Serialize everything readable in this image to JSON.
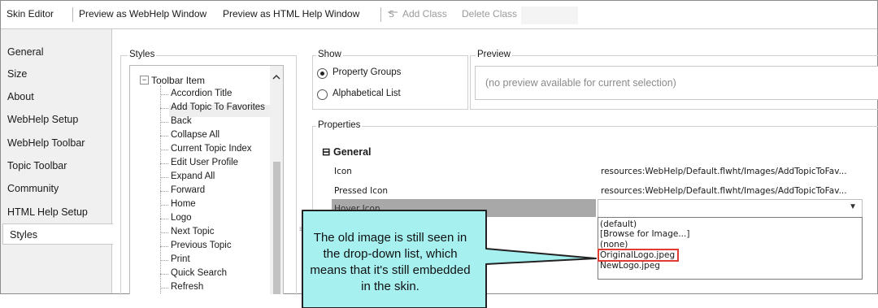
{
  "toolbar": {
    "skin_editor": "Skin Editor",
    "preview_webhelp": "Preview as WebHelp Window",
    "preview_htmlhelp": "Preview as HTML Help Window",
    "add_class": "Add Class",
    "delete_class": "Delete Class",
    "add_class_icon": "class-icon"
  },
  "nav": {
    "items": [
      {
        "label": "General"
      },
      {
        "label": "Size"
      },
      {
        "label": "About"
      },
      {
        "label": "WebHelp Setup"
      },
      {
        "label": "WebHelp Toolbar"
      },
      {
        "label": "Topic Toolbar"
      },
      {
        "label": "Community"
      },
      {
        "label": "HTML Help Setup"
      },
      {
        "label": "Styles"
      }
    ],
    "selected": "Styles"
  },
  "styles": {
    "group_label": "Styles",
    "root": "Toolbar Item",
    "items": [
      "Accordion Title",
      "Add Topic To Favorites",
      "Back",
      "Collapse All",
      "Current Topic Index",
      "Edit User Profile",
      "Expand All",
      "Forward",
      "Home",
      "Logo",
      "Next Topic",
      "Previous Topic",
      "Print",
      "Quick Search",
      "Refresh"
    ],
    "selected": "Add Topic To Favorites"
  },
  "show": {
    "group_label": "Show",
    "options": [
      "Property Groups",
      "Alphabetical List"
    ],
    "selected": "Property Groups"
  },
  "preview": {
    "group_label": "Preview",
    "text": "(no preview available for current selection)"
  },
  "properties": {
    "group_label": "Properties",
    "section_toggle": "⊟",
    "section": "General",
    "rows": [
      {
        "name": "Icon",
        "value": "resources:WebHelp/Default.flwht/Images/AddTopicToFav..."
      },
      {
        "name": "Pressed Icon",
        "value": "resources:WebHelp/Default.flwht/Images/AddTopicToFav..."
      },
      {
        "name": "Hover Icon",
        "value": ""
      }
    ],
    "dropdown_options": [
      "(default)",
      "[Browse for Image...]",
      "(none)",
      "OriginalLogo.jpeg",
      "NewLogo.jpeg"
    ],
    "highlighted_option": "OriginalLogo.jpeg"
  },
  "callout": {
    "text": "The old image is still seen in the drop-down list, which means that it's still embedded in the skin."
  },
  "colors": {
    "callout_fill": "#a6f0f0",
    "highlight_border": "#e03c31",
    "hover_row": "#a8a8a8"
  }
}
